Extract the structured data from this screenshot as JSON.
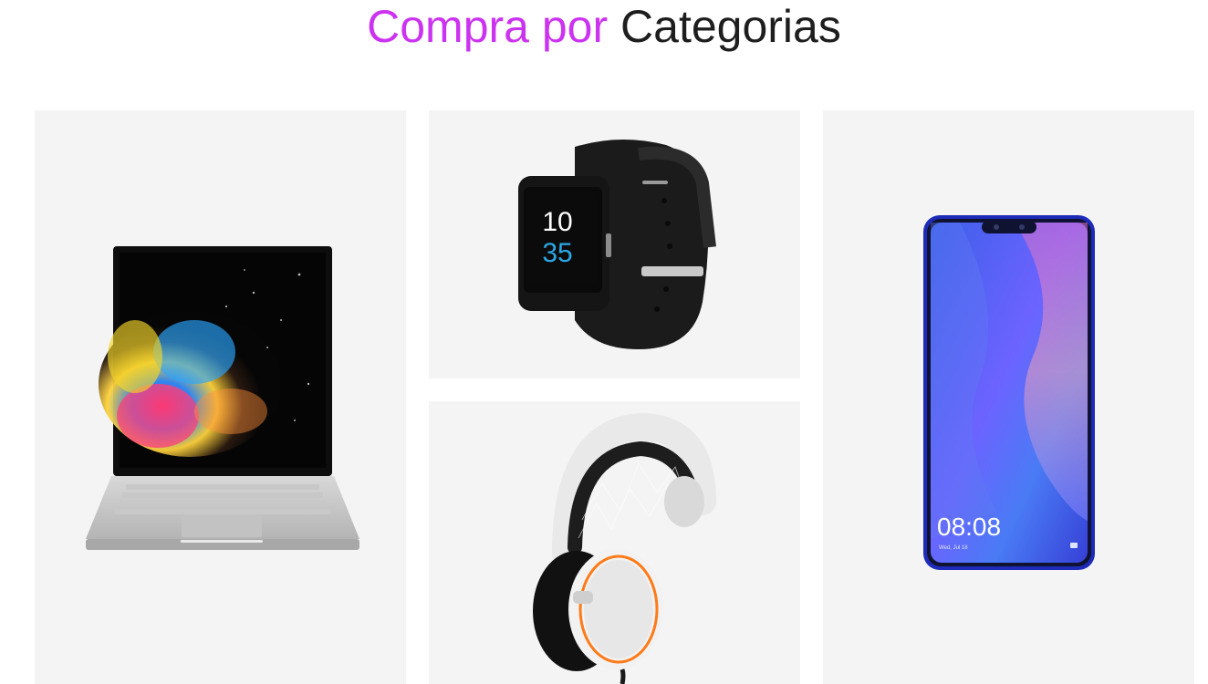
{
  "header": {
    "title_accent": "Compra por",
    "title_rest": "Categorias",
    "accent_color": "#cc33f0"
  },
  "categories": [
    {
      "icon": "laptop-icon"
    },
    {
      "icon": "smartwatch-icon"
    },
    {
      "icon": "headphones-icon"
    },
    {
      "icon": "smartphone-icon"
    }
  ],
  "products": {
    "watch_time_hours": "10",
    "watch_time_minutes": "35",
    "phone_time": "08:08",
    "phone_date": "Wed, Jul 18"
  }
}
